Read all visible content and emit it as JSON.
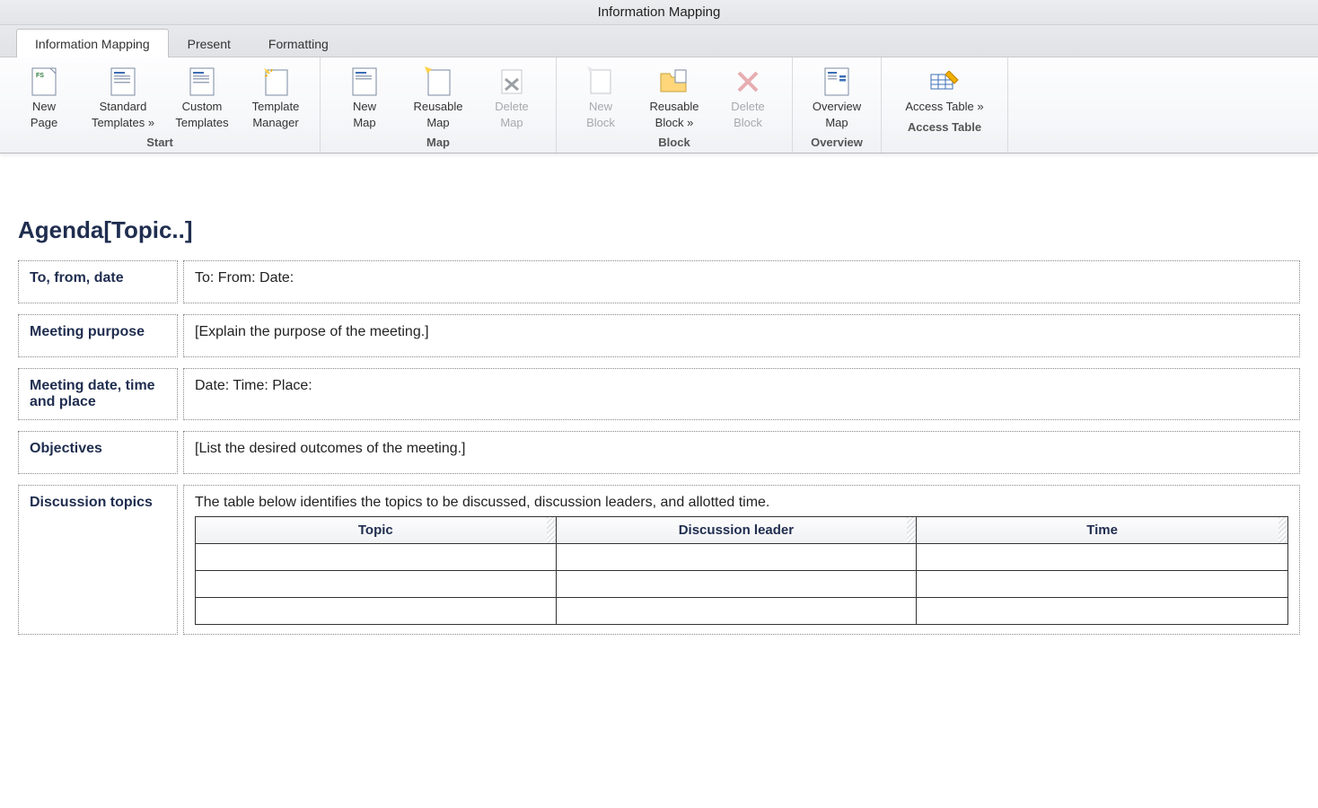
{
  "window_title": "Information Mapping",
  "tabs": [
    {
      "label": "Information Mapping",
      "active": true
    },
    {
      "label": "Present",
      "active": false
    },
    {
      "label": "Formatting",
      "active": false
    }
  ],
  "ribbon": {
    "start": {
      "label": "Start",
      "items": [
        {
          "line1": "New",
          "line2": "Page",
          "icon": "page-fs"
        },
        {
          "line1": "Standard",
          "line2": "Templates »",
          "icon": "page-lines"
        },
        {
          "line1": "Custom",
          "line2": "Templates",
          "icon": "page-lines"
        },
        {
          "line1": "Template",
          "line2": "Manager",
          "icon": "page-spark"
        }
      ]
    },
    "map": {
      "label": "Map",
      "items": [
        {
          "line1": "New",
          "line2": "Map",
          "icon": "page-lines"
        },
        {
          "line1": "Reusable",
          "line2": "Map",
          "icon": "page-spark"
        },
        {
          "line1": "Delete",
          "line2": "Map",
          "icon": "page-x",
          "disabled": true
        }
      ]
    },
    "block": {
      "label": "Block",
      "items": [
        {
          "line1": "New",
          "line2": "Block",
          "icon": "page-dot",
          "disabled": true
        },
        {
          "line1": "Reusable",
          "line2": "Block »",
          "icon": "folder"
        },
        {
          "line1": "Delete",
          "line2": "Block",
          "icon": "x-plain",
          "disabled": true
        }
      ]
    },
    "overview": {
      "label": "Overview",
      "items": [
        {
          "line1": "Overview",
          "line2": "Map",
          "icon": "page-list"
        }
      ]
    },
    "access": {
      "label": "Access Table",
      "items": [
        {
          "line1": "Access Table »",
          "icon": "table-pencil"
        }
      ]
    }
  },
  "doc": {
    "title": "Agenda[Topic..]",
    "rows": [
      {
        "label": "To, from, date",
        "body": "To: From: Date:"
      },
      {
        "label": "Meeting purpose",
        "body": "[Explain the purpose of the meeting.]"
      },
      {
        "label": "Meeting date, time and place",
        "body": "Date: Time: Place:"
      },
      {
        "label": "Objectives",
        "body": "[List the desired outcomes of the meeting.]"
      }
    ],
    "discussion": {
      "label": "Discussion topics",
      "intro": "The table below identifies the topics to be discussed, discussion leaders, and allotted time.",
      "columns": [
        "Topic",
        "Discussion leader",
        "Time"
      ],
      "rows": [
        [
          "",
          "",
          ""
        ],
        [
          "",
          "",
          ""
        ],
        [
          "",
          "",
          ""
        ]
      ]
    }
  }
}
